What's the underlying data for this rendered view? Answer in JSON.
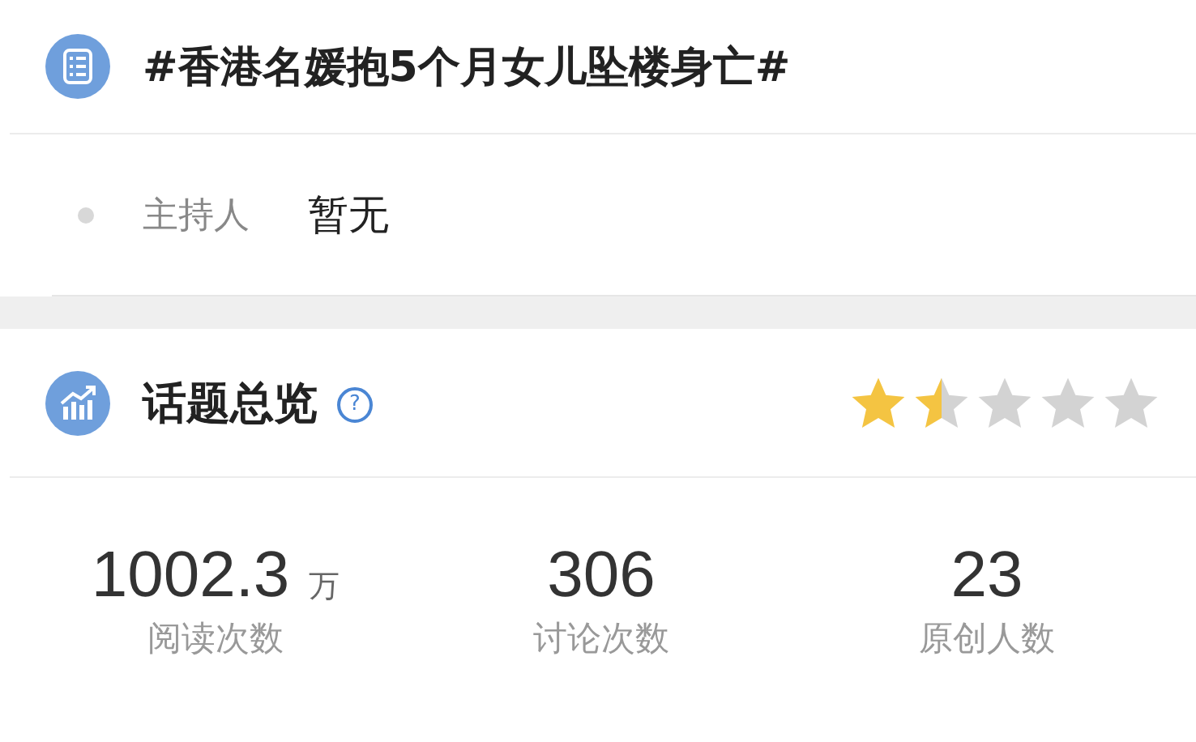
{
  "topic": {
    "title": "#香港名媛抱5个月女儿坠楼身亡#"
  },
  "host": {
    "label": "主持人",
    "value": "暂无"
  },
  "overview": {
    "title": "话题总览",
    "help": "?",
    "stars": 1.5
  },
  "stats": [
    {
      "value": "1002.3",
      "unit": "万",
      "label": "阅读次数"
    },
    {
      "value": "306",
      "label": "讨论次数"
    },
    {
      "value": "23",
      "label": "原创人数"
    }
  ]
}
